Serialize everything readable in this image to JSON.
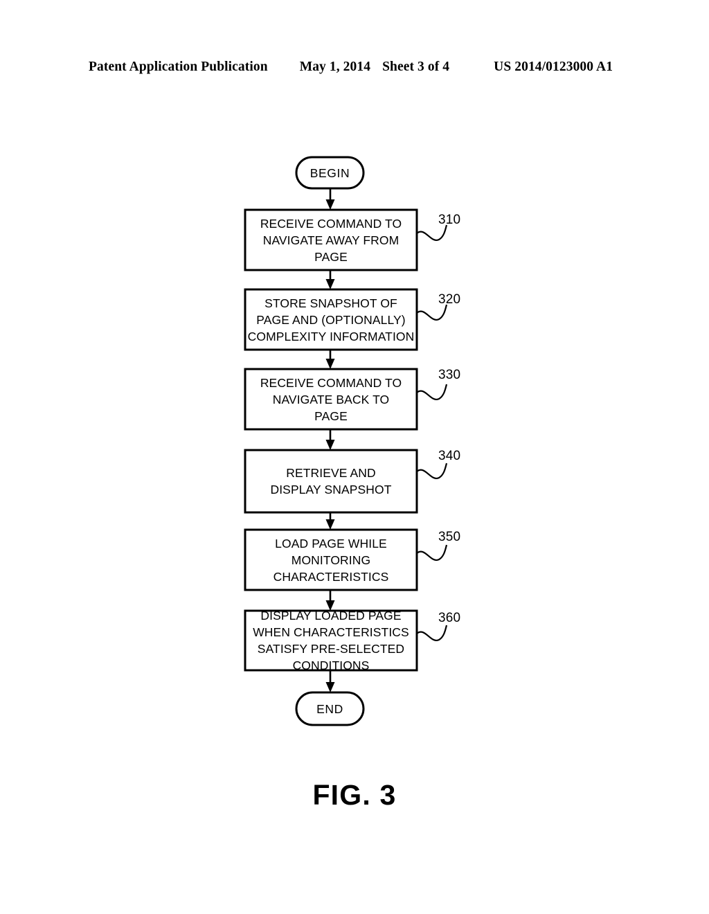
{
  "header": {
    "publication": "Patent Application Publication",
    "date": "May 1, 2014",
    "sheet": "Sheet 3 of 4",
    "patent_number": "US 2014/0123000 A1"
  },
  "figure": {
    "caption": "FIG. 3",
    "line_color": "#000000",
    "background_color": "#ffffff"
  },
  "flowchart": {
    "start": {
      "label": "BEGIN",
      "shape": "rounded-terminal"
    },
    "end": {
      "label": "END",
      "shape": "rounded-terminal"
    },
    "steps": [
      {
        "ref": "310",
        "label": "RECEIVE COMMAND TO\nNAVIGATE AWAY FROM\nPAGE"
      },
      {
        "ref": "320",
        "label": "STORE SNAPSHOT OF\nPAGE AND (OPTIONALLY)\nCOMPLEXITY INFORMATION"
      },
      {
        "ref": "330",
        "label": "RECEIVE COMMAND TO\nNAVIGATE BACK TO\nPAGE"
      },
      {
        "ref": "340",
        "label": "RETRIEVE AND\nDISPLAY SNAPSHOT"
      },
      {
        "ref": "350",
        "label": "LOAD PAGE WHILE\nMONITORING\nCHARACTERISTICS"
      },
      {
        "ref": "360",
        "label": "DISPLAY LOADED PAGE\nWHEN CHARACTERISTICS\nSATISFY PRE-SELECTED\nCONDITIONS"
      }
    ]
  }
}
